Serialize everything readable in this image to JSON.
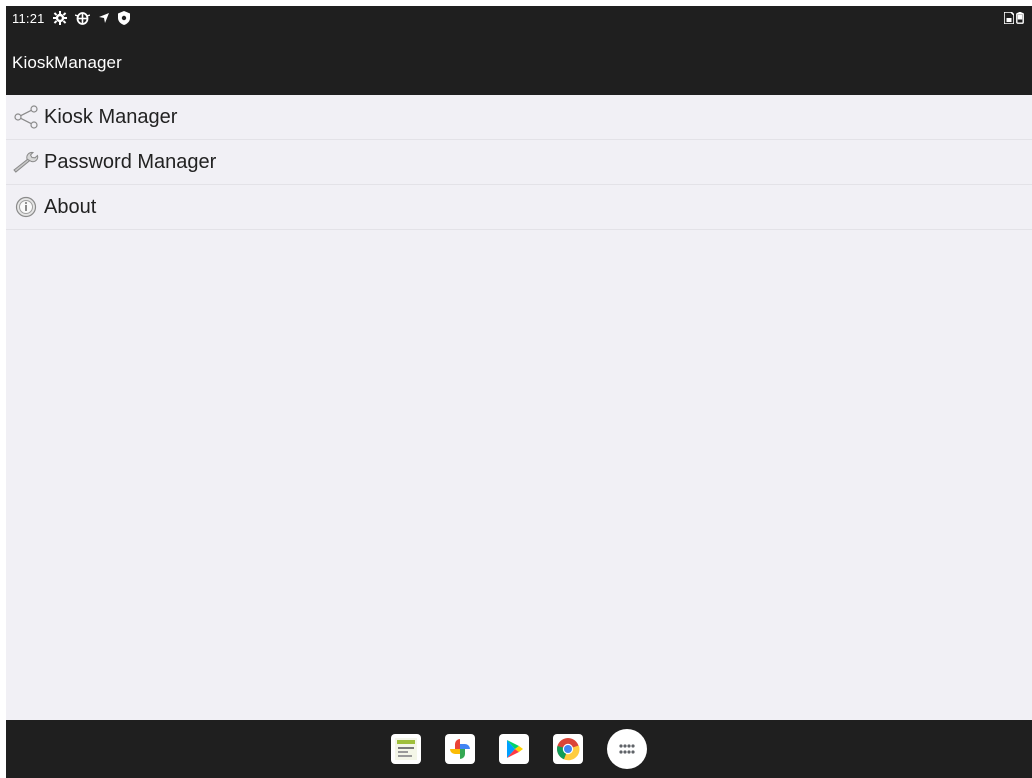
{
  "status_bar": {
    "time": "11:21",
    "left_icons": [
      "settings-icon",
      "bug-icon",
      "navigation-icon",
      "shield-icon"
    ],
    "right_icons": [
      "sim-card-icon",
      "battery-icon"
    ]
  },
  "app_bar": {
    "title": "KioskManager"
  },
  "menu": {
    "items": [
      {
        "icon": "share-icon",
        "label": "Kiosk Manager"
      },
      {
        "icon": "wrench-icon",
        "label": "Password Manager"
      },
      {
        "icon": "info-icon",
        "label": "About"
      }
    ]
  },
  "dock": {
    "apps": [
      {
        "icon": "kiosk-app-icon"
      },
      {
        "icon": "photos-icon"
      },
      {
        "icon": "play-store-icon"
      },
      {
        "icon": "chrome-icon"
      },
      {
        "icon": "app-drawer-icon"
      }
    ]
  },
  "colors": {
    "bar_background": "#1f1f1f",
    "content_background": "#f1f0f5",
    "divider": "#e3e2e7",
    "text": "#222222"
  }
}
